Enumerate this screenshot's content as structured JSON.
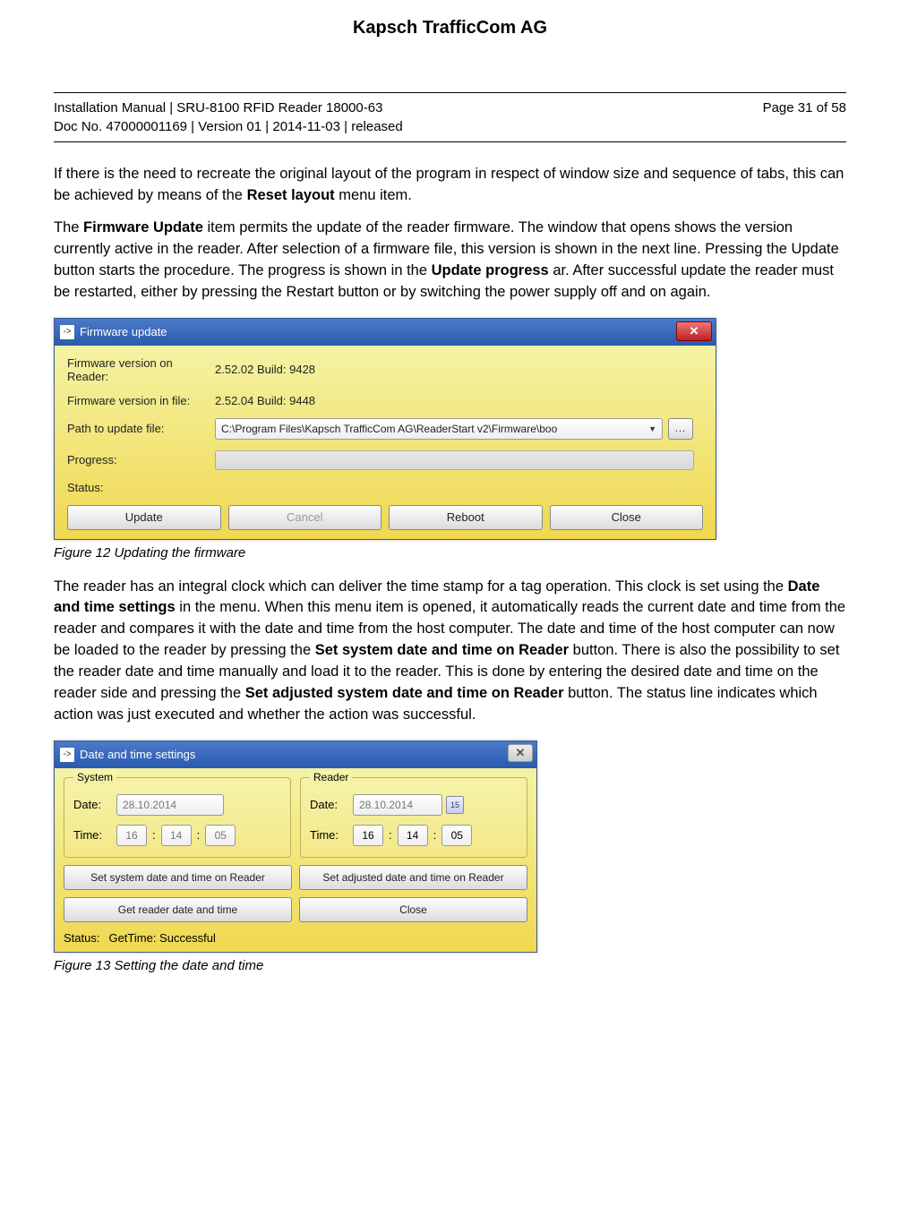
{
  "header": {
    "company": "Kapsch TrafficCom AG"
  },
  "meta": {
    "line1": "Installation Manual | SRU-8100 RFID Reader 18000-63",
    "line2": "Doc No. 47000001169 | Version 01 | 2014-11-03 | released",
    "page": "Page 31 of 58"
  },
  "paragraphs": {
    "p1a": "If there is the need to recreate the original layout of the program in respect of window size and sequence of tabs, this can be achieved by means of the ",
    "p1b": "Reset layout",
    "p1c": " menu item.",
    "p2a": "The ",
    "p2b": "Firmware Update",
    "p2c": " item permits the update of the reader firmware. The window that opens shows the version currently active in the reader. After selection of a firmware file, this version is shown in the next line. Pressing the Update button starts the procedure. The progress is shown in the ",
    "p2d": "Update progress",
    "p2e": " ar. After successful update the reader must be restarted, either by pressing the Restart button or by switching the power supply off and on again.",
    "p3a": "The reader has an integral clock which can deliver the time stamp for a tag operation. This clock is set using the ",
    "p3b": "Date and time settings",
    "p3c": " in the menu. When this menu item is opened, it automatically reads the current date and time from the reader and compares it with the date and time from the host computer. The date and time of the host computer can now be loaded to the reader by pressing the ",
    "p3d": "Set system date and time on Reader",
    "p3e": " button. There is also the possibility to set the reader date and time manually and load it to the reader. This is done by entering the desired date and time on the reader side and pressing the ",
    "p3f": "Set adjusted system date and time on Reader",
    "p3g": " button. The status line indicates which action was just executed and whether the action was successful."
  },
  "firmware_dialog": {
    "title": "Firmware update",
    "labels": {
      "version_reader": "Firmware version on Reader:",
      "version_file": "Firmware version in file:",
      "path": "Path to update file:",
      "progress": "Progress:",
      "status": "Status:"
    },
    "values": {
      "version_reader": "2.52.02 Build: 9428",
      "version_file": "2.52.04 Build: 9448",
      "path": "C:\\Program Files\\Kapsch TrafficCom AG\\ReaderStart v2\\Firmware\\boo"
    },
    "buttons": {
      "update": "Update",
      "cancel": "Cancel",
      "reboot": "Reboot",
      "close": "Close",
      "browse": "..."
    }
  },
  "figure12": "Figure 12    Updating the firmware",
  "datetime_dialog": {
    "title": "Date and time settings",
    "groups": {
      "system": "System",
      "reader": "Reader"
    },
    "labels": {
      "date": "Date:",
      "time": "Time:",
      "status": "Status:"
    },
    "system": {
      "date": "28.10.2014",
      "h": "16",
      "m": "14",
      "s": "05"
    },
    "reader": {
      "date": "28.10.2014",
      "h": "16",
      "m": "14",
      "s": "05",
      "cal": "15"
    },
    "buttons": {
      "set_system": "Set system date and time on Reader",
      "set_adjusted": "Set adjusted date and time on Reader",
      "get": "Get reader date and time",
      "close": "Close"
    },
    "status_value": "GetTime: Successful"
  },
  "figure13": "Figure 13    Setting the date and time"
}
